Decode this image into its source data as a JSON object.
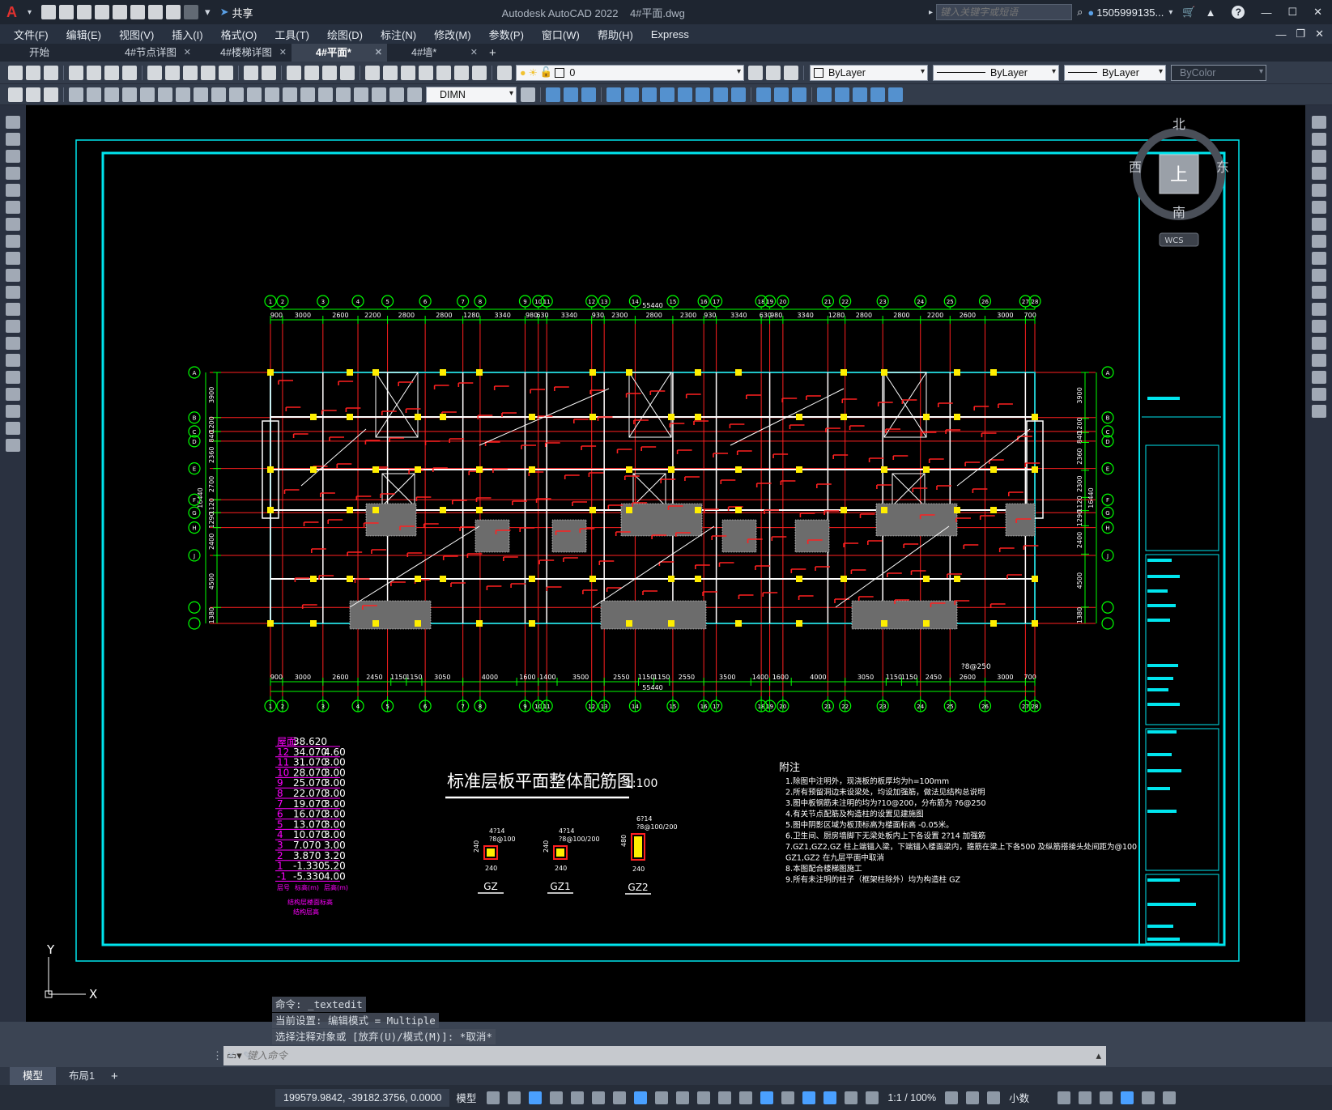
{
  "window": {
    "app_title": "Autodesk AutoCAD 2022",
    "file_title": "4#平面.dwg",
    "search_placeholder": "键入关键字或短语",
    "user": "1505999135...",
    "share_label": "共享"
  },
  "menu": [
    "文件(F)",
    "编辑(E)",
    "视图(V)",
    "插入(I)",
    "格式(O)",
    "工具(T)",
    "绘图(D)",
    "标注(N)",
    "修改(M)",
    "参数(P)",
    "窗口(W)",
    "帮助(H)",
    "Express"
  ],
  "tabs": [
    {
      "label": "开始",
      "active": false
    },
    {
      "label": "4#节点详图",
      "active": false
    },
    {
      "label": "4#楼梯详图",
      "active": false
    },
    {
      "label": "4#平面*",
      "active": true
    },
    {
      "label": "4#墙*",
      "active": false
    }
  ],
  "properties": {
    "layer": "0",
    "color": "ByLayer",
    "linetype": "ByLayer",
    "lineweight": "ByLayer",
    "plotstyle": "ByColor",
    "dimstyle": "DIMN"
  },
  "viewcube": {
    "north": "北",
    "south": "南",
    "east": "东",
    "west": "西",
    "face": "上",
    "wcs": "WCS"
  },
  "drawing": {
    "title": "标准层板平面整体配筋图",
    "scale": "1:100",
    "overall_dim": "55440",
    "side_dim": "16440",
    "top_dims": [
      "900",
      "3000",
      "2600",
      "2200",
      "2800",
      "2800",
      "1280",
      "3340",
      "980",
      "630",
      "3340",
      "930",
      "2300",
      "2800",
      "2300",
      "930",
      "3340",
      "630",
      "980",
      "3340",
      "1280",
      "2800",
      "2800",
      "2200",
      "2600",
      "3000",
      "700"
    ],
    "bottom_dims": [
      "900",
      "3000",
      "2600",
      "2450",
      "1150",
      "1150",
      "3050",
      "4000",
      "1600",
      "1400",
      "3500",
      "2550",
      "1150",
      "1150",
      "2550",
      "3500",
      "1400",
      "1600",
      "4000",
      "3050",
      "1150",
      "1150",
      "2450",
      "2600",
      "3000",
      "700"
    ],
    "left_dims": [
      "3900",
      "1200",
      "840",
      "2360",
      "2700",
      "1120",
      "1290",
      "2400",
      "4500",
      "1380"
    ],
    "right_dims": [
      "3900",
      "1200",
      "840",
      "2360",
      "2300",
      "1120",
      "1290",
      "2400",
      "4500",
      "1380"
    ],
    "grid_axes_top": [
      "1",
      "2",
      "3",
      "4",
      "5",
      "6",
      "7",
      "8",
      "9",
      "10",
      "11",
      "12",
      "13",
      "14",
      "15",
      "16",
      "17",
      "18",
      "19",
      "20",
      "21",
      "22",
      "23",
      "24",
      "25",
      "26",
      "27",
      "28"
    ],
    "grid_axes_side": [
      "A",
      "B",
      "C",
      "D",
      "E",
      "F",
      "G",
      "H",
      "J"
    ],
    "annotation": "?8@250",
    "floor_table_title": "结构层楼面标高",
    "floor_table_subtitle": "结构层高",
    "floor_table_header": [
      "层号",
      "标高(m)",
      "层高(m)"
    ],
    "floor_table": [
      [
        "屋面",
        "38.620",
        ""
      ],
      [
        "12",
        "34.070",
        "4.60"
      ],
      [
        "11",
        "31.070",
        "3.00"
      ],
      [
        "10",
        "28.070",
        "3.00"
      ],
      [
        "9",
        "25.070",
        "3.00"
      ],
      [
        "8",
        "22.070",
        "3.00"
      ],
      [
        "7",
        "19.070",
        "3.00"
      ],
      [
        "6",
        "16.070",
        "3.00"
      ],
      [
        "5",
        "13.070",
        "3.00"
      ],
      [
        "4",
        "10.070",
        "3.00"
      ],
      [
        "3",
        "7.070",
        "3.00"
      ],
      [
        "2",
        "3.870",
        "3.20"
      ],
      [
        "1",
        "-1.330",
        "5.20"
      ],
      [
        "-1",
        "-5.330",
        "4.00"
      ]
    ],
    "columns": [
      {
        "name": "GZ",
        "bars": "4?14",
        "stirrup": "?8@100",
        "w": "240",
        "h": "240"
      },
      {
        "name": "GZ1",
        "bars": "4?14",
        "stirrup": "?8@100/200",
        "w": "240",
        "h": "240"
      },
      {
        "name": "GZ2",
        "bars": "6?14",
        "stirrup": "?8@100/200",
        "w": "240",
        "h": "480"
      }
    ],
    "notes_title": "附注",
    "notes": [
      "1.除图中注明外，现浇板的板厚均为h=100mm",
      "2.所有预留洞边未设梁处，均设加强筋，做法见结构总说明",
      "3.图中板钢筋未注明的均为?10@200，分布筋为 ?6@250",
      "4.有关节点配筋及构造柱的设置见建施图",
      "5.图中阴影区域为板顶标高为楼面标高 -0.05米。",
      "6.卫生间、厨房墙脚下无梁处板内上下各设置 2?14 加强筋",
      "7.GZ1,GZ2,GZ 柱上端锚入梁，下端锚入楼面梁内，箍筋在梁上下各500 及纵筋搭接头处间距为@100",
      "   GZ1,GZ2 在九层平面中取消",
      "8.本图配合楼梯图施工",
      "9.所有未注明的柱子（框架柱除外）均为构造柱 GZ"
    ]
  },
  "command": {
    "history": [
      "命令: _textedit",
      "当前设置: 编辑模式 = Multiple",
      "选择注释对象或 [放弃(U)/模式(M)]: *取消*"
    ],
    "placeholder": "键入命令"
  },
  "layout_tabs": [
    "模型",
    "布局1"
  ],
  "status": {
    "coords": "199579.9842, -39182.3756, 0.0000",
    "space": "模型",
    "annotation_scale": "1:1 / 100%",
    "units": "小数"
  },
  "colors": {
    "frame": "#00e5ee",
    "grid": "#00ff00",
    "beam": "#ff2020",
    "column": "#ffee00",
    "wall": "#ffffff",
    "note": "#ff00ff"
  }
}
